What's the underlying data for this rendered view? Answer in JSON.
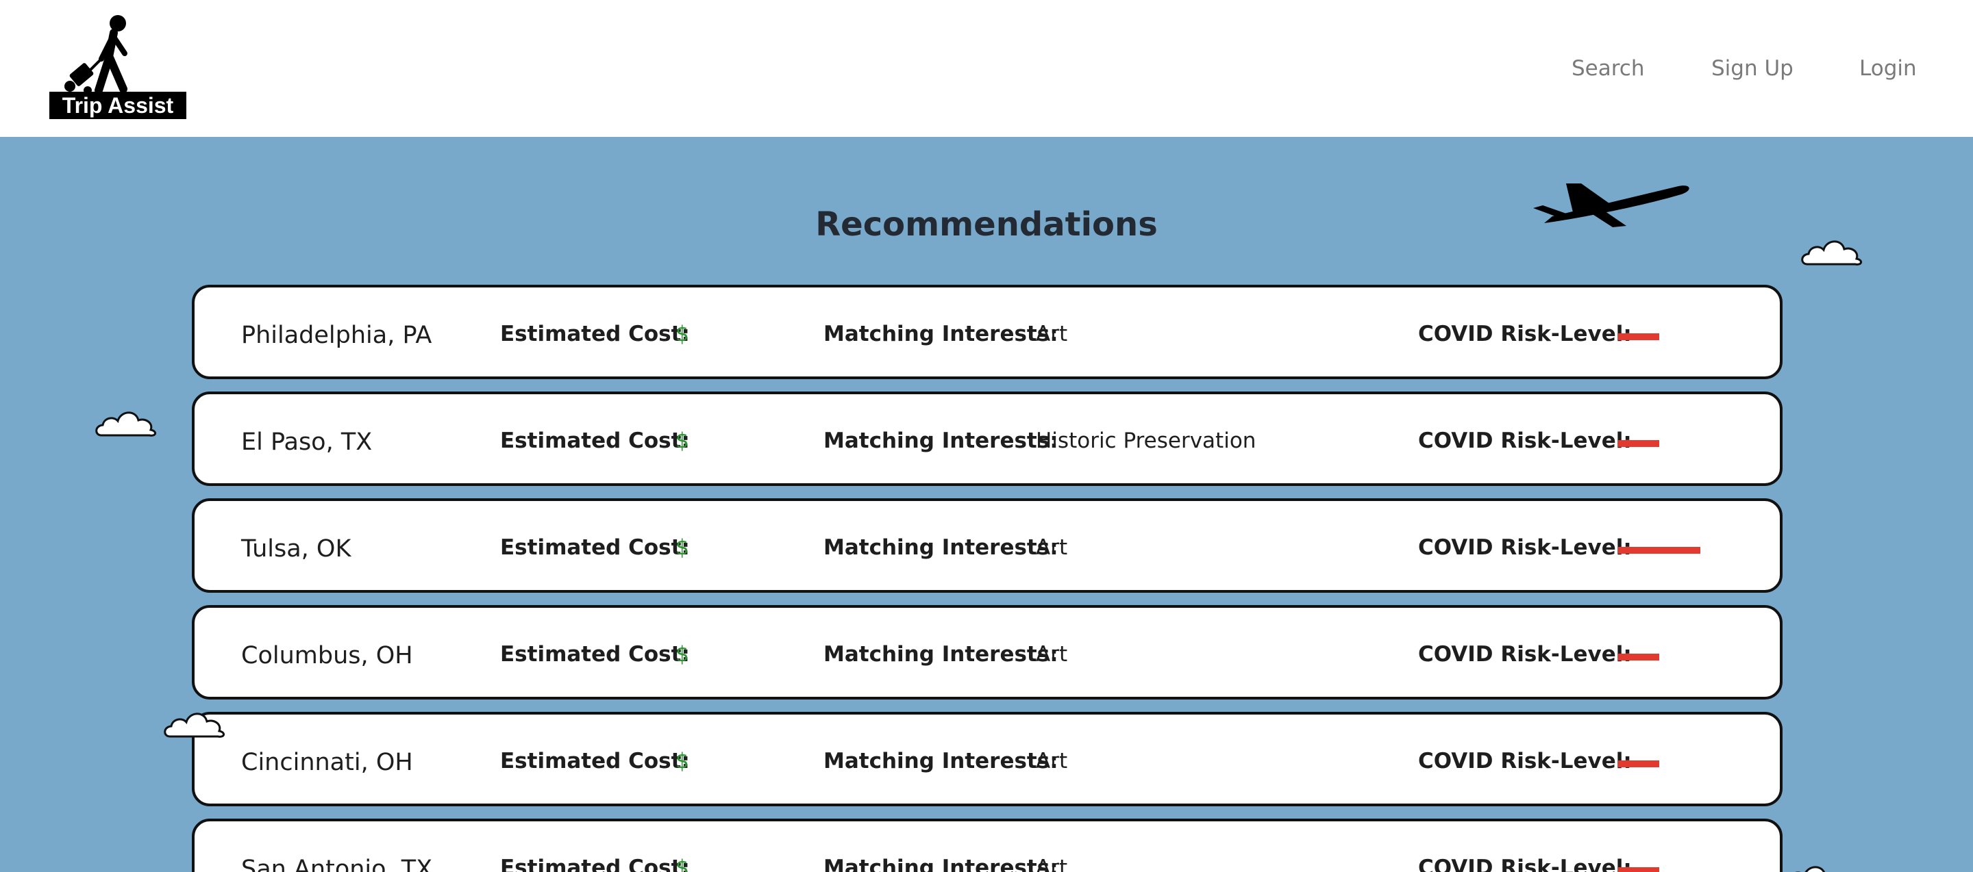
{
  "brand": {
    "name": "Trip Assist"
  },
  "nav": {
    "search": "Search",
    "signup": "Sign Up",
    "login": "Login"
  },
  "page": {
    "title": "Recommendations"
  },
  "labels": {
    "cost": "Estimated Cost:",
    "interests": "Matching Interests:",
    "risk": "COVID Risk-Level:"
  },
  "colors": {
    "sky": "#78a9cb",
    "cost": "#2e9134",
    "risk": "#e23a2f"
  },
  "recommendations": [
    {
      "city": "Philadelphia, PA",
      "cost": "$",
      "interests": "Art",
      "risk_level": 1
    },
    {
      "city": "El Paso, TX",
      "cost": "$",
      "interests": "Historic Preservation",
      "risk_level": 1
    },
    {
      "city": "Tulsa, OK",
      "cost": "$",
      "interests": "Art",
      "risk_level": 2
    },
    {
      "city": "Columbus, OH",
      "cost": "$",
      "interests": "Art",
      "risk_level": 1
    },
    {
      "city": "Cincinnati, OH",
      "cost": "$",
      "interests": "Art",
      "risk_level": 1
    },
    {
      "city": "San Antonio, TX",
      "cost": "$",
      "interests": "Art",
      "risk_level": 1
    }
  ]
}
